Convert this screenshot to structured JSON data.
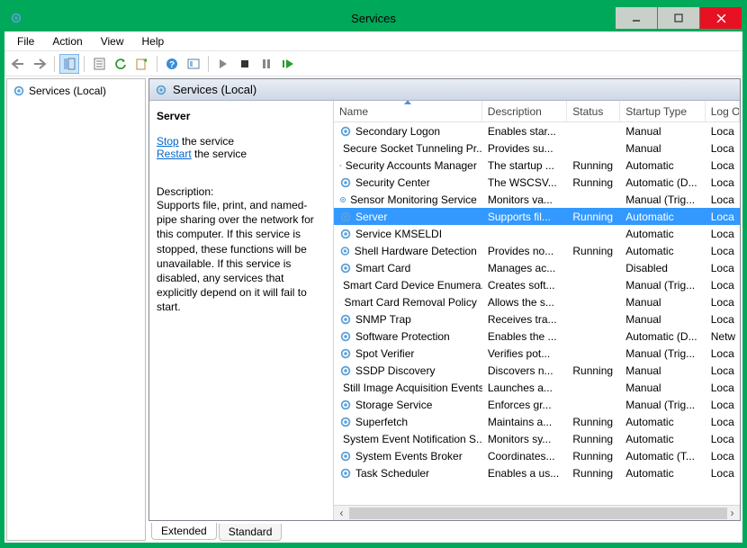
{
  "window": {
    "title": "Services"
  },
  "menu": {
    "file": "File",
    "action": "Action",
    "view": "View",
    "help": "Help"
  },
  "tree": {
    "root": "Services (Local)"
  },
  "pane": {
    "title": "Services (Local)"
  },
  "detail": {
    "name": "Server",
    "stop": "Stop",
    "stop_suffix": " the service",
    "restart": "Restart",
    "restart_suffix": " the service",
    "desc_label": "Description:",
    "desc": "Supports file, print, and named-pipe sharing over the network for this computer. If this service is stopped, these functions will be unavailable. If this service is disabled, any services that explicitly depend on it will fail to start."
  },
  "columns": {
    "name": "Name",
    "description": "Description",
    "status": "Status",
    "startup": "Startup Type",
    "logon": "Log On As"
  },
  "services": [
    {
      "name": "Secondary Logon",
      "desc": "Enables star...",
      "status": "",
      "startup": "Manual",
      "logon": "Loca"
    },
    {
      "name": "Secure Socket Tunneling Pr...",
      "desc": "Provides su...",
      "status": "",
      "startup": "Manual",
      "logon": "Loca"
    },
    {
      "name": "Security Accounts Manager",
      "desc": "The startup ...",
      "status": "Running",
      "startup": "Automatic",
      "logon": "Loca"
    },
    {
      "name": "Security Center",
      "desc": "The WSCSV...",
      "status": "Running",
      "startup": "Automatic (D...",
      "logon": "Loca"
    },
    {
      "name": "Sensor Monitoring Service",
      "desc": "Monitors va...",
      "status": "",
      "startup": "Manual (Trig...",
      "logon": "Loca"
    },
    {
      "name": "Server",
      "desc": "Supports fil...",
      "status": "Running",
      "startup": "Automatic",
      "logon": "Loca",
      "selected": true
    },
    {
      "name": "Service KMSELDI",
      "desc": "",
      "status": "",
      "startup": "Automatic",
      "logon": "Loca"
    },
    {
      "name": "Shell Hardware Detection",
      "desc": "Provides no...",
      "status": "Running",
      "startup": "Automatic",
      "logon": "Loca"
    },
    {
      "name": "Smart Card",
      "desc": "Manages ac...",
      "status": "",
      "startup": "Disabled",
      "logon": "Loca"
    },
    {
      "name": "Smart Card Device Enumera...",
      "desc": "Creates soft...",
      "status": "",
      "startup": "Manual (Trig...",
      "logon": "Loca"
    },
    {
      "name": "Smart Card Removal Policy",
      "desc": "Allows the s...",
      "status": "",
      "startup": "Manual",
      "logon": "Loca"
    },
    {
      "name": "SNMP Trap",
      "desc": "Receives tra...",
      "status": "",
      "startup": "Manual",
      "logon": "Loca"
    },
    {
      "name": "Software Protection",
      "desc": "Enables the ...",
      "status": "",
      "startup": "Automatic (D...",
      "logon": "Netw"
    },
    {
      "name": "Spot Verifier",
      "desc": "Verifies pot...",
      "status": "",
      "startup": "Manual (Trig...",
      "logon": "Loca"
    },
    {
      "name": "SSDP Discovery",
      "desc": "Discovers n...",
      "status": "Running",
      "startup": "Manual",
      "logon": "Loca"
    },
    {
      "name": "Still Image Acquisition Events",
      "desc": "Launches a...",
      "status": "",
      "startup": "Manual",
      "logon": "Loca"
    },
    {
      "name": "Storage Service",
      "desc": "Enforces gr...",
      "status": "",
      "startup": "Manual (Trig...",
      "logon": "Loca"
    },
    {
      "name": "Superfetch",
      "desc": "Maintains a...",
      "status": "Running",
      "startup": "Automatic",
      "logon": "Loca"
    },
    {
      "name": "System Event Notification S...",
      "desc": "Monitors sy...",
      "status": "Running",
      "startup": "Automatic",
      "logon": "Loca"
    },
    {
      "name": "System Events Broker",
      "desc": "Coordinates...",
      "status": "Running",
      "startup": "Automatic (T...",
      "logon": "Loca"
    },
    {
      "name": "Task Scheduler",
      "desc": "Enables a us...",
      "status": "Running",
      "startup": "Automatic",
      "logon": "Loca"
    }
  ],
  "tabs": {
    "extended": "Extended",
    "standard": "Standard"
  }
}
